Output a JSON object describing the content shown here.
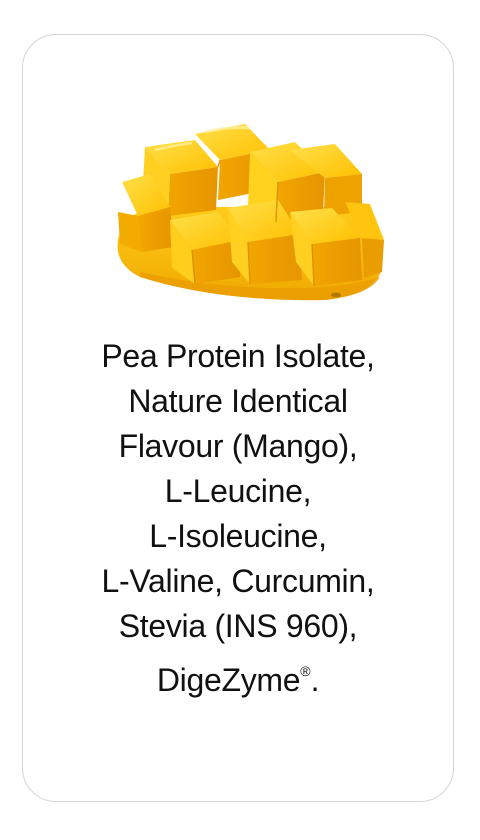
{
  "card": {
    "image": {
      "icon": "mango-cubes-illustration",
      "colors": {
        "flesh": "#f6b400",
        "highlight": "#ffd21e",
        "shade": "#e99a00",
        "skin": "#c98a00"
      }
    },
    "ingredients": {
      "lines": [
        "Pea Protein Isolate,",
        "Nature Identical",
        "Flavour (Mango),",
        "L-Leucine,",
        "L-Isoleucine,",
        "L-Valine, Curcumin,",
        "Stevia (INS 960),",
        "DigeZyme"
      ],
      "trademark": "®",
      "terminal": "."
    }
  }
}
